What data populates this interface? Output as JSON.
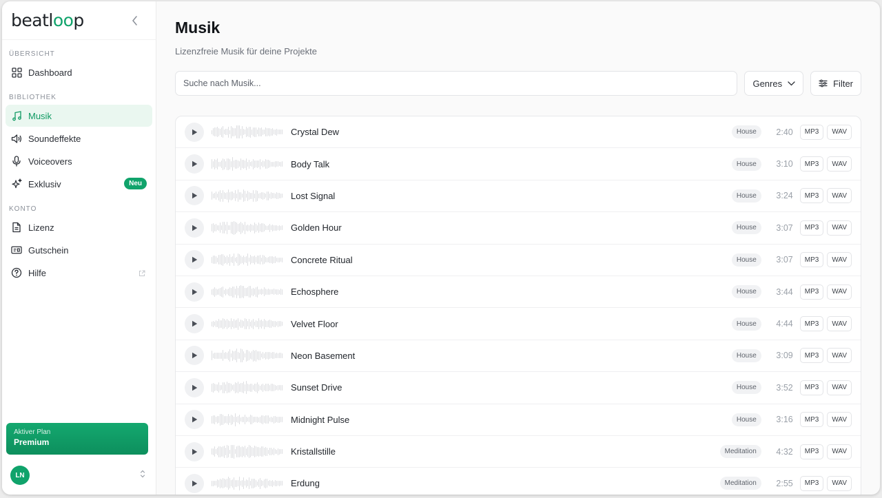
{
  "app": {
    "logo_prefix": "beatl",
    "logo_oo": "oo",
    "logo_suffix": "p"
  },
  "sidebar": {
    "sections": [
      {
        "label": "ÜBERSICHT"
      },
      {
        "label": "BIBLIOTHEK"
      },
      {
        "label": "KONTO"
      }
    ],
    "items": {
      "dashboard": {
        "label": "Dashboard",
        "icon": "grid-icon"
      },
      "musik": {
        "label": "Musik",
        "icon": "music-note-icon"
      },
      "soundeffekte": {
        "label": "Soundeffekte",
        "icon": "speaker-icon"
      },
      "voiceovers": {
        "label": "Voiceovers",
        "icon": "microphone-icon"
      },
      "exklusiv": {
        "label": "Exklusiv",
        "icon": "sparkles-icon",
        "badge": "Neu"
      },
      "lizenz": {
        "label": "Lizenz",
        "icon": "document-icon"
      },
      "gutschein": {
        "label": "Gutschein",
        "icon": "voucher-icon"
      },
      "hilfe": {
        "label": "Hilfe",
        "icon": "help-circle-icon"
      }
    },
    "plan": {
      "label": "Aktiver Plan",
      "name": "Premium"
    },
    "user": {
      "initials": "LN"
    }
  },
  "main": {
    "title": "Musik",
    "subtitle": "Lizenzfreie Musik für deine Projekte",
    "search_placeholder": "Suche nach Musik...",
    "genres_label": "Genres",
    "filter_label": "Filter"
  },
  "tracks": [
    {
      "name": "Crystal Dew",
      "genre": "House",
      "duration": "2:40"
    },
    {
      "name": "Body Talk",
      "genre": "House",
      "duration": "3:10"
    },
    {
      "name": "Lost Signal",
      "genre": "House",
      "duration": "3:24"
    },
    {
      "name": "Golden Hour",
      "genre": "House",
      "duration": "3:07"
    },
    {
      "name": "Concrete Ritual",
      "genre": "House",
      "duration": "3:07"
    },
    {
      "name": "Echosphere",
      "genre": "House",
      "duration": "3:44"
    },
    {
      "name": "Velvet Floor",
      "genre": "House",
      "duration": "4:44"
    },
    {
      "name": "Neon Basement",
      "genre": "House",
      "duration": "3:09"
    },
    {
      "name": "Sunset Drive",
      "genre": "House",
      "duration": "3:52"
    },
    {
      "name": "Midnight Pulse",
      "genre": "House",
      "duration": "3:16"
    },
    {
      "name": "Kristallstille",
      "genre": "Meditation",
      "duration": "4:32"
    },
    {
      "name": "Erdung",
      "genre": "Meditation",
      "duration": "2:55"
    }
  ],
  "formats": [
    "MP3",
    "WAV"
  ],
  "colors": {
    "accent": "#10a36b",
    "active_bg": "#eaf7f0"
  }
}
